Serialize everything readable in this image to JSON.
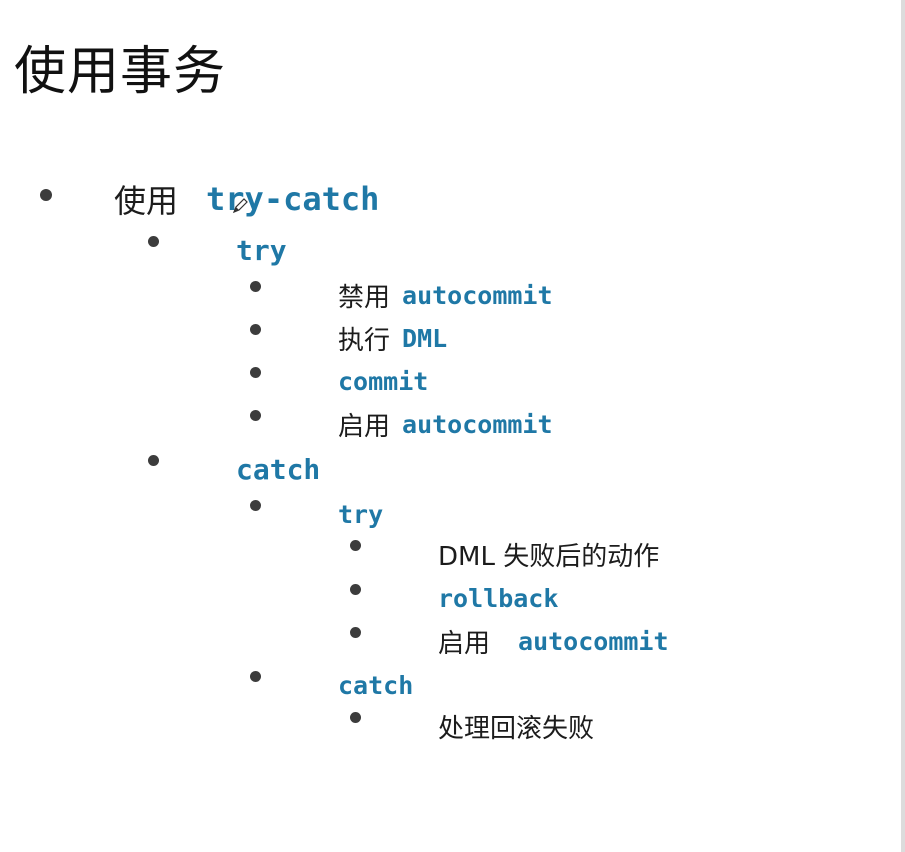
{
  "title": "使用事务",
  "outline": {
    "use_try_catch": {
      "text": "使用",
      "code": "try-catch"
    },
    "try": {
      "label": "try",
      "items": [
        {
          "text": "禁用",
          "code": "autocommit"
        },
        {
          "text": "执行",
          "code": "DML"
        },
        {
          "text": "",
          "code": "commit"
        },
        {
          "text": "启用",
          "code": "autocommit"
        }
      ]
    },
    "catch": {
      "label": "catch",
      "inner_try": {
        "label": "try",
        "items": [
          {
            "text": "DML 失败后的动作",
            "code": ""
          },
          {
            "text": "",
            "code": "rollback"
          },
          {
            "text": "启用",
            "code": "autocommit"
          }
        ]
      },
      "inner_catch": {
        "label": "catch",
        "items": [
          {
            "text": "处理回滚失败",
            "code": ""
          }
        ]
      }
    }
  },
  "icons": {
    "bullet": "bullet-dot-icon",
    "cursor": "pencil-cursor-icon"
  },
  "colors": {
    "code": "#1f78a6",
    "text": "#1c1c1c",
    "bullet": "#3c3c3c",
    "background": "#ffffff"
  }
}
